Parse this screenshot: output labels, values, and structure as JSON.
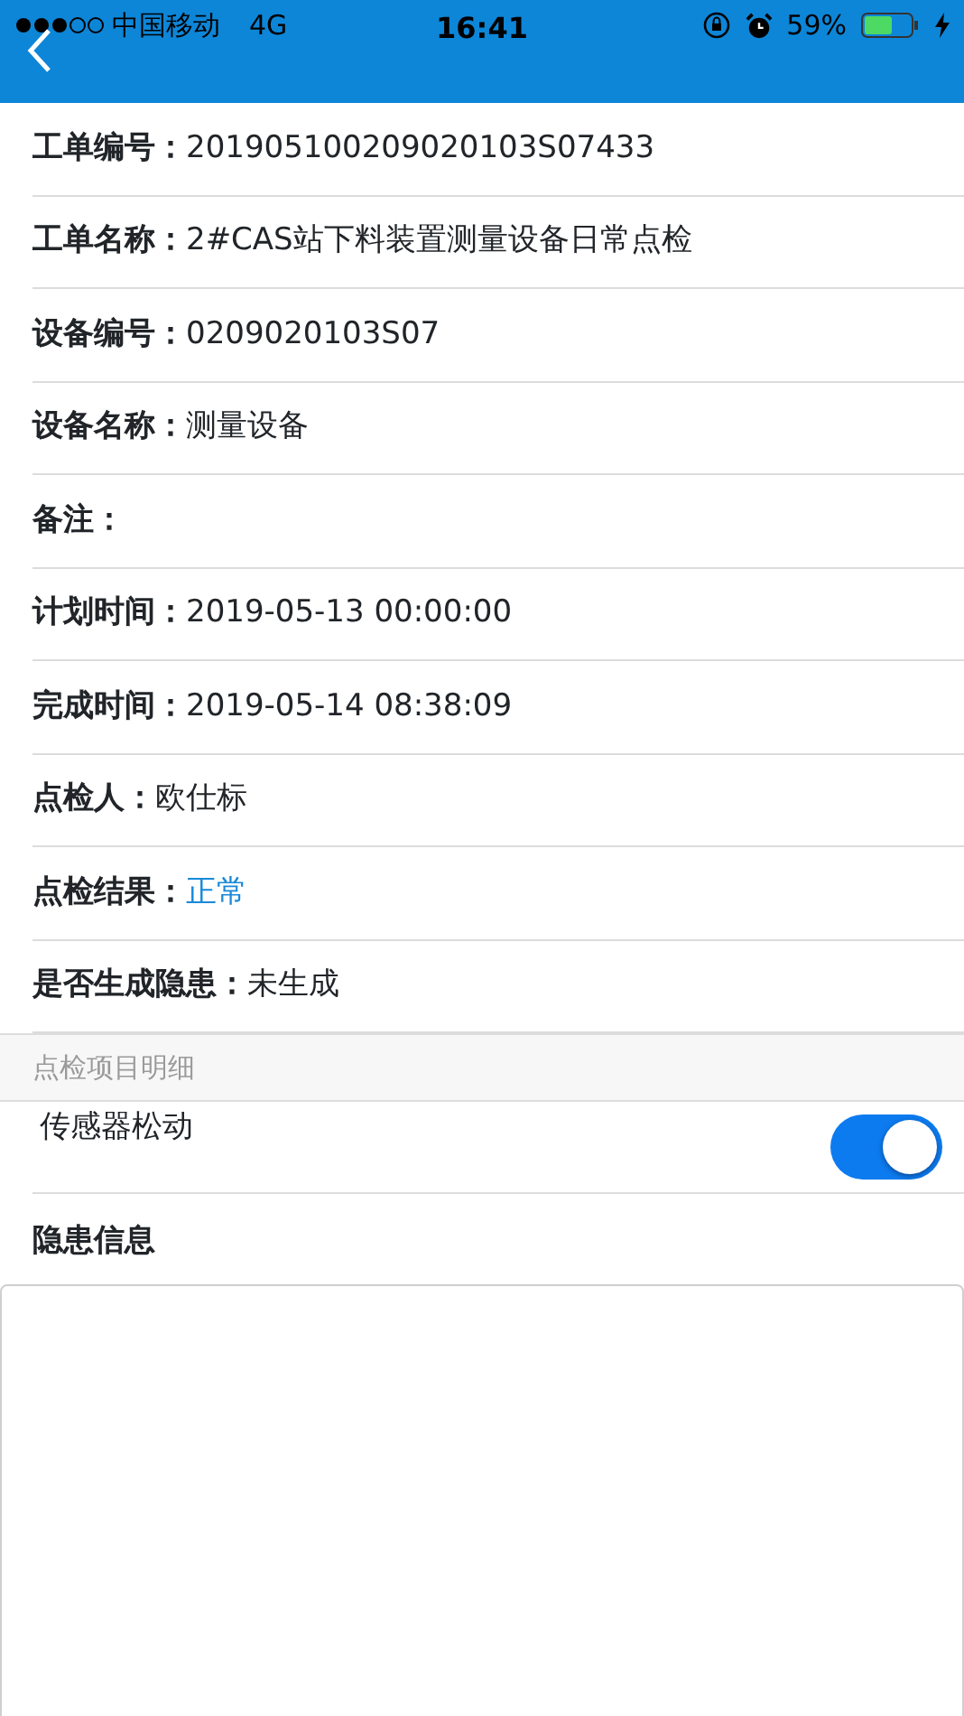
{
  "status_bar": {
    "carrier": "中国移动",
    "network": "4G",
    "time": "16:41",
    "battery": "59%"
  },
  "fields": [
    {
      "label": "工单编号：",
      "value": "201905100209020103S07433",
      "kind": "plain"
    },
    {
      "label": "工单名称：",
      "value": "2#CAS站下料装置测量设备日常点检",
      "kind": "plain"
    },
    {
      "label": "设备编号：",
      "value": "0209020103S07",
      "kind": "plain"
    },
    {
      "label": "设备名称：",
      "value": "测量设备",
      "kind": "plain"
    },
    {
      "label": "备注："
    },
    {
      "label": "计划时间：",
      "value": "2019-05-13 00:00:00",
      "kind": "plain"
    },
    {
      "label": "完成时间：",
      "value": "2019-05-14 08:38:09",
      "kind": "plain"
    },
    {
      "label": "点检人：",
      "value": "欧仕标",
      "kind": "plain"
    },
    {
      "label": "点检结果：",
      "value": "正常",
      "kind": "status"
    },
    {
      "label": "是否生成隐患：",
      "value": "未生成",
      "kind": "plain"
    }
  ],
  "section_title": "点检项目明细",
  "check_items": [
    {
      "label": "传感器松动",
      "on": true
    }
  ],
  "hazard_info": {
    "title": "隐患信息"
  }
}
